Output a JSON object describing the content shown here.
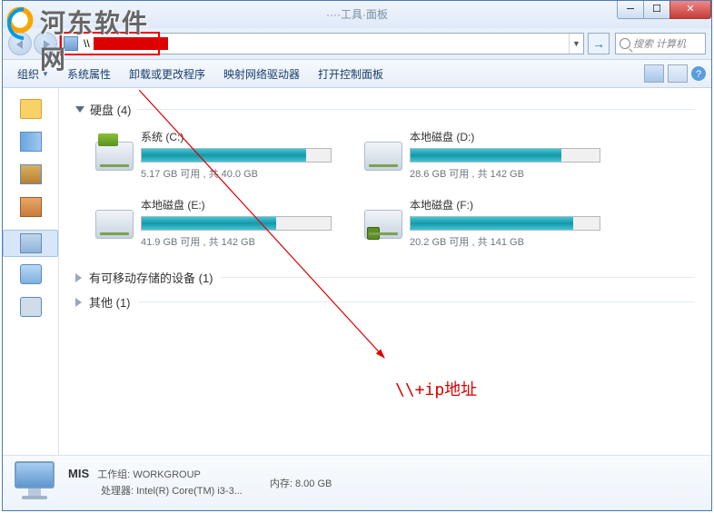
{
  "watermark_text": "河东软件网",
  "window": {
    "title_hint": "····工具·面板"
  },
  "address": {
    "prefix": "\\\\",
    "redacted": true
  },
  "search": {
    "placeholder": "搜索 计算机"
  },
  "toolbar": {
    "organize": "组织",
    "props": "系统属性",
    "uninstall": "卸载或更改程序",
    "mapdrive": "映射网络驱动器",
    "ctrlpanel": "打开控制面板"
  },
  "groups": {
    "hdd": {
      "label": "硬盘 (4)"
    },
    "removable": {
      "label": "有可移动存储的设备 (1)"
    },
    "other": {
      "label": "其他 (1)"
    }
  },
  "drives": [
    {
      "name": "系统 (C:)",
      "stats": "5.17 GB 可用 , 共 40.0 GB",
      "fill": 87
    },
    {
      "name": "本地磁盘 (D:)",
      "stats": "28.6 GB 可用 , 共 142 GB",
      "fill": 80
    },
    {
      "name": "本地磁盘 (E:)",
      "stats": "41.9 GB 可用 , 共 142 GB",
      "fill": 71
    },
    {
      "name": "本地磁盘 (F:)",
      "stats": "20.2 GB 可用 , 共 141 GB",
      "fill": 86,
      "badge": true
    }
  ],
  "annotation": {
    "label": "\\\\+ip地址"
  },
  "details": {
    "name": "MIS",
    "workgroup_label": "工作组:",
    "workgroup": "WORKGROUP",
    "cpu_label": "处理器:",
    "cpu": "Intel(R) Core(TM) i3-3...",
    "mem_label": "内存:",
    "mem": "8.00 GB"
  }
}
